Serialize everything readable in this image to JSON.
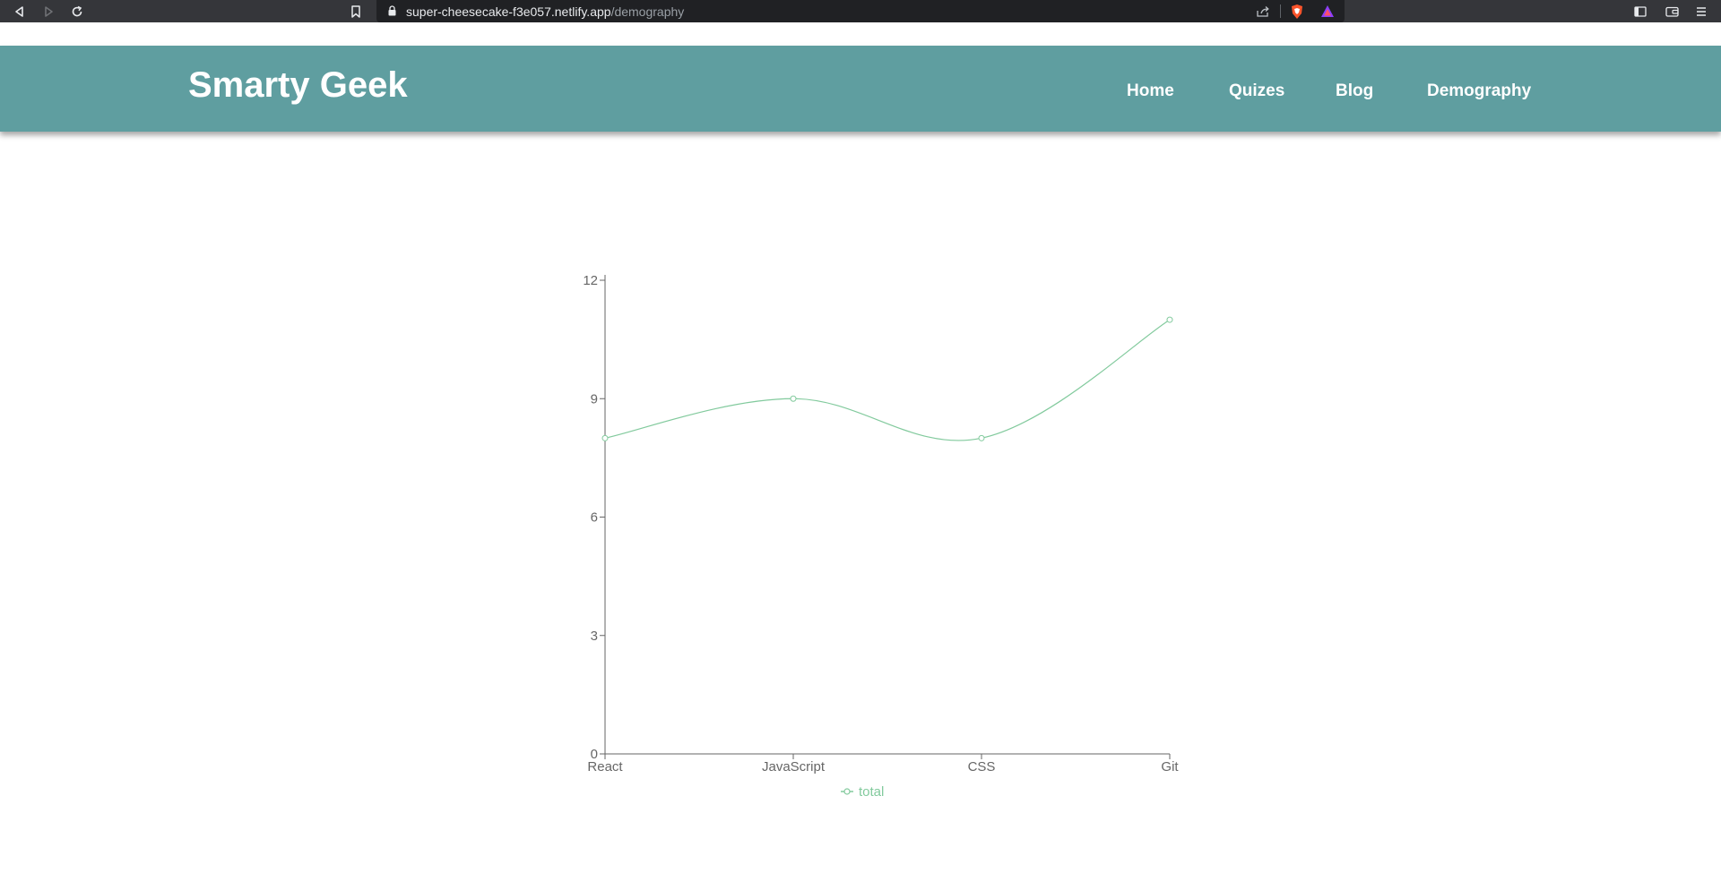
{
  "browser": {
    "url_host": "super-cheesecake-f3e057.netlify.app",
    "url_path": "/demography",
    "icons": [
      "back-icon",
      "forward-icon",
      "reload-icon",
      "bookmark-icon",
      "lock-icon",
      "share-icon",
      "brave-shield-icon",
      "brave-rewards-icon",
      "sidebar-icon",
      "wallet-icon",
      "menu-icon"
    ]
  },
  "header": {
    "brand": "Smarty Geek",
    "nav": [
      {
        "label": "Home"
      },
      {
        "label": "Quizes"
      },
      {
        "label": "Blog"
      },
      {
        "label": "Demography"
      }
    ],
    "background": "#5f9ea0"
  },
  "chart_data": {
    "type": "line",
    "categories": [
      "React",
      "JavaScript",
      "CSS",
      "Git"
    ],
    "series": [
      {
        "name": "total",
        "values": [
          8,
          9,
          8,
          11
        ],
        "color": "#82ca9d"
      }
    ],
    "ylim": [
      0,
      12
    ],
    "yticks": [
      0,
      3,
      6,
      9,
      12
    ],
    "grid": false,
    "legend": "bottom-center",
    "title": "",
    "xlabel": "",
    "ylabel": ""
  }
}
